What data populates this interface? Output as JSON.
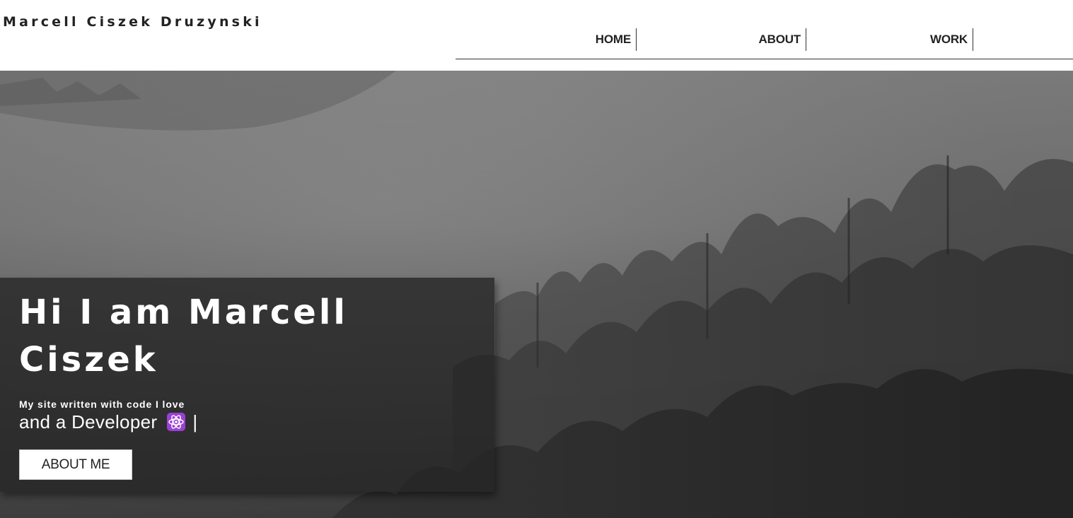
{
  "header": {
    "site_title": "Marcell Ciszek Druzynski",
    "nav": {
      "home": "HOME",
      "about": "ABOUT",
      "work": "WORK"
    }
  },
  "hero": {
    "background": "misty-forest-photo",
    "heading": "Hi I am Marcell Ciszek",
    "tagline": "My site written with code I love",
    "role_text": "and a Developer",
    "role_icon": "atom-icon",
    "cursor": "|",
    "button_label": "ABOUT ME"
  },
  "colors": {
    "text_dark": "#222222",
    "overlay": "#262626",
    "atom_icon": "#9b3fd6"
  }
}
